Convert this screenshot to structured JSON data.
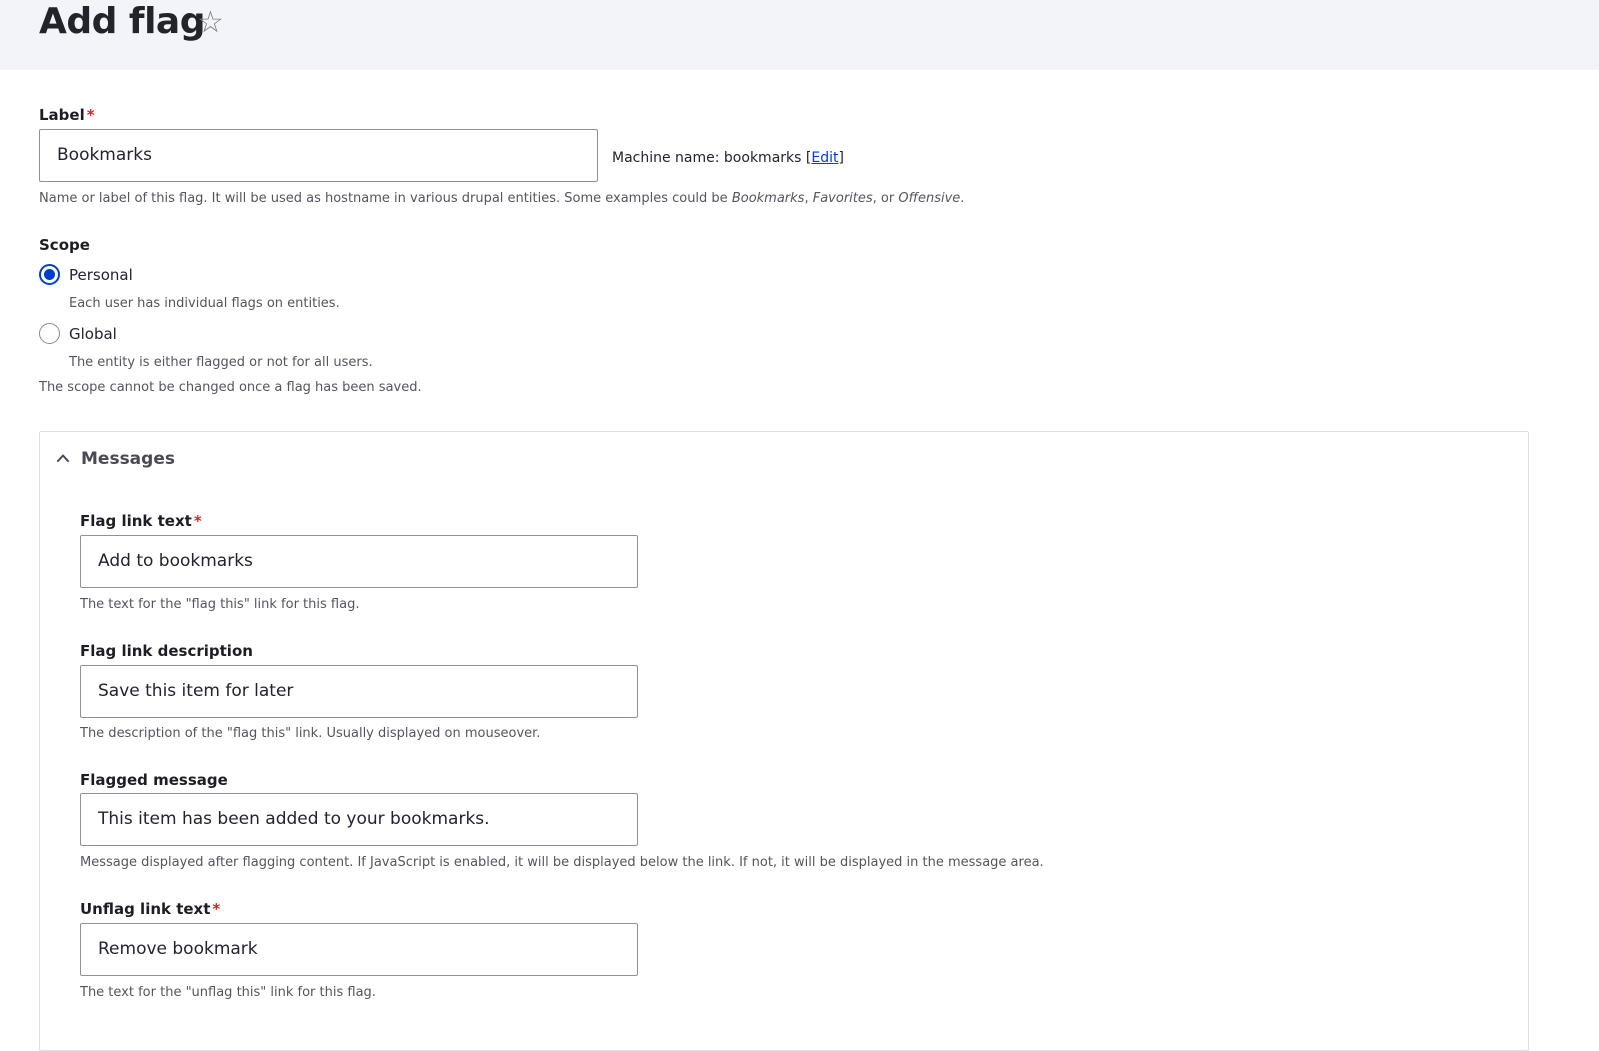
{
  "page": {
    "title": "Add flag",
    "favorite_icon": "star-outline-icon"
  },
  "label_field": {
    "label": "Label",
    "required_marker": "*",
    "value": "Bookmarks",
    "machine_name_prefix": "Machine name: bookmarks [",
    "machine_name_edit": "Edit",
    "machine_name_suffix": "]",
    "description_prefix": "Name or label of this flag. It will be used as hostname in various drupal entities. Some examples could be ",
    "description_ex1": "Bookmarks",
    "description_sep1": ", ",
    "description_ex2": "Favorites",
    "description_sep2": ", or ",
    "description_ex3": "Offensive",
    "description_end": "."
  },
  "scope": {
    "label": "Scope",
    "options": [
      {
        "label": "Personal",
        "description": "Each user has individual flags on entities.",
        "checked": true
      },
      {
        "label": "Global",
        "description": "The entity is either flagged or not for all users.",
        "checked": false
      }
    ],
    "note": "The scope cannot be changed once a flag has been saved."
  },
  "messages": {
    "summary": "Messages",
    "expanded": true,
    "fields": [
      {
        "label": "Flag link text",
        "required": true,
        "value": "Add to bookmarks",
        "description": "The text for the \"flag this\" link for this flag."
      },
      {
        "label": "Flag link description",
        "required": false,
        "value": "Save this item for later",
        "description": "The description of the \"flag this\" link. Usually displayed on mouseover."
      },
      {
        "label": "Flagged message",
        "required": false,
        "value": "This item has been added to your bookmarks.",
        "description": "Message displayed after flagging content. If JavaScript is enabled, it will be displayed below the link. If not, it will be displayed in the message area."
      },
      {
        "label": "Unflag link text",
        "required": true,
        "value": "Remove bookmark",
        "description": "The text for the \"unflag this\" link for this flag."
      }
    ]
  },
  "colors": {
    "header_bg": "#f3f4f9",
    "link": "#003ecc",
    "required": "#d72222",
    "radio_checked": "#003ecc"
  }
}
